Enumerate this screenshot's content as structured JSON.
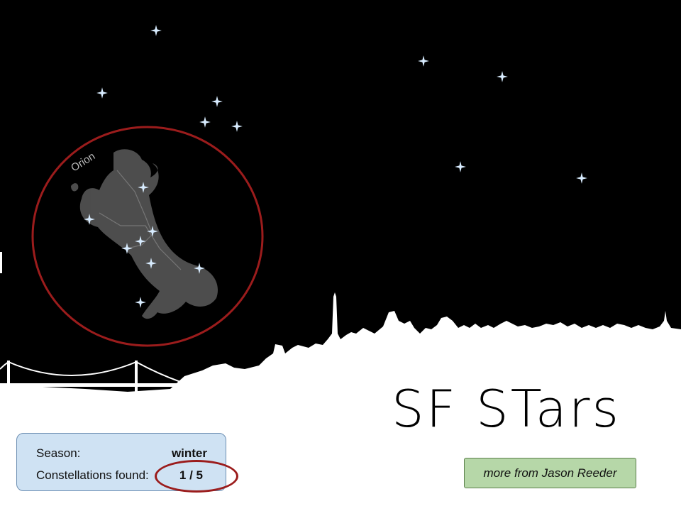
{
  "game": {
    "title": "SF Stars",
    "title_display": "SF STars",
    "highlight_color": "#9b1c1c",
    "star_color": "#d8ecff"
  },
  "status": {
    "season_label": "Season:",
    "season_value": "winter",
    "found_label": "Constellations found:",
    "found_value": "1 / 5",
    "found_count": 1,
    "total_count": 5
  },
  "constellation": {
    "name": "Orion",
    "found": true
  },
  "link": {
    "label": "more from Jason Reeder"
  }
}
